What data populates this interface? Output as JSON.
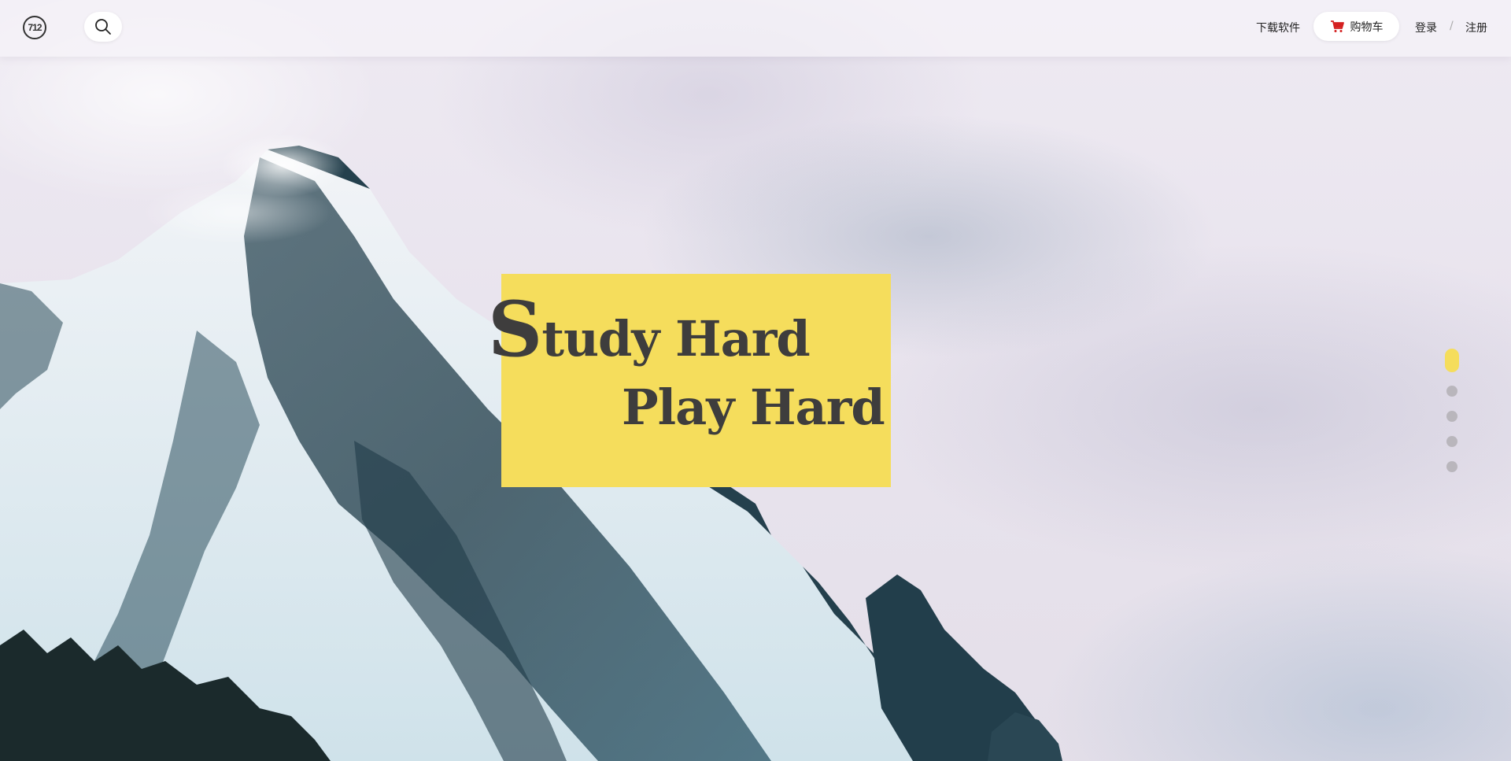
{
  "header": {
    "logo_text": "712",
    "download_label": "下载软件",
    "cart_label": "购物车",
    "login_label": "登录",
    "separator": "/",
    "register_label": "注册"
  },
  "hero": {
    "line1_initial": "S",
    "line1_rest": "tudy Hard",
    "line2": "Play Hard"
  },
  "slider": {
    "total": 5,
    "active_index": 0
  },
  "colors": {
    "accent": "#f5dd5c",
    "text_dark": "#3e3d3d",
    "cart_icon": "#d42020",
    "dot_inactive": "#b9b6bc"
  },
  "icons": {
    "search": "search-icon",
    "cart": "cart-icon",
    "logo": "logo-icon"
  }
}
